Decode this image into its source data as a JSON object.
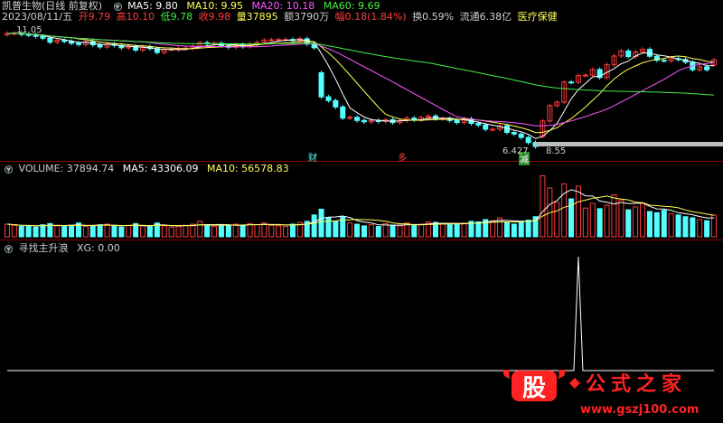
{
  "colors": {
    "up": "#ff3b3b",
    "down": "#54ffff",
    "ma5": "#ffffff",
    "ma10": "#ffff55",
    "ma20": "#ff55ff",
    "ma60": "#44ee44",
    "bg": "#000000"
  },
  "header": {
    "title": "凯普生物(日线 前复权)",
    "ma5": "MA5: 9.80",
    "ma10": "MA10: 9.95",
    "ma20": "MA20: 10.18",
    "ma60": "MA60: 9.69"
  },
  "info": {
    "date": "2023/08/11/五",
    "open": "开9.79",
    "high": "高10.10",
    "low": "低9.78",
    "close": "收9.98",
    "volume": "量37895",
    "amount": "额3790万",
    "change": "幅0.18(1.84%)",
    "turnover": "换0.59%",
    "float": "流通6.38亿",
    "sector": "医疗保健"
  },
  "price_annotations": {
    "high_mark": "11.05",
    "low_mark": "6.427",
    "tag1": "财",
    "tag2": "多",
    "tag3": "减",
    "low_suffix": "8.55"
  },
  "volume_header": {
    "name": "VOLUME: 37894.74",
    "ma5": "MA5: 43306.09",
    "ma10": "MA10: 56578.83"
  },
  "indicator_header": {
    "name": "寻找主升浪",
    "xg": "XG: 0.00"
  },
  "logo": {
    "char": "股",
    "text": "公式之家",
    "url": "www.gszj100.com"
  },
  "chart_data": [
    {
      "type": "candlestick",
      "panel": "price",
      "count": 100,
      "close": [
        10.98,
        10.99,
        10.94,
        10.93,
        10.87,
        10.8,
        10.65,
        10.72,
        10.68,
        10.61,
        10.56,
        10.67,
        10.55,
        10.47,
        10.58,
        10.53,
        10.44,
        10.49,
        10.35,
        10.48,
        10.41,
        10.26,
        10.38,
        10.38,
        10.41,
        10.43,
        10.5,
        10.63,
        10.59,
        10.61,
        10.52,
        10.46,
        10.56,
        10.48,
        10.58,
        10.64,
        10.73,
        10.74,
        10.75,
        10.75,
        10.71,
        10.78,
        10.58,
        10.44,
        8.59,
        8.45,
        8.21,
        7.79,
        7.82,
        7.7,
        7.65,
        7.7,
        7.66,
        7.73,
        7.62,
        7.7,
        7.79,
        7.72,
        7.81,
        7.87,
        7.77,
        7.77,
        7.7,
        7.62,
        7.76,
        7.59,
        7.53,
        7.37,
        7.37,
        7.5,
        7.25,
        7.19,
        7.06,
        6.87,
        6.72,
        7.68,
        8.26,
        8.39,
        9.15,
        9.14,
        9.39,
        9.41,
        9.62,
        9.32,
        9.8,
        10.13,
        10.32,
        10.11,
        10.28,
        10.38,
        10.12,
        9.97,
        9.95,
        10.03,
        10.0,
        9.9,
        9.61,
        9.72,
        9.61,
        9.98
      ],
      "open": [
        10.93,
        10.98,
        10.99,
        10.94,
        10.93,
        10.87,
        10.8,
        10.65,
        10.72,
        10.68,
        10.61,
        10.56,
        10.67,
        10.55,
        10.47,
        10.58,
        10.53,
        10.44,
        10.49,
        10.35,
        10.48,
        10.41,
        10.26,
        10.38,
        10.38,
        10.41,
        10.43,
        10.5,
        10.63,
        10.59,
        10.61,
        10.52,
        10.46,
        10.56,
        10.48,
        10.58,
        10.64,
        10.73,
        10.74,
        10.75,
        10.75,
        10.71,
        10.78,
        10.58,
        9.5,
        8.59,
        8.45,
        8.21,
        7.79,
        7.82,
        7.7,
        7.65,
        7.7,
        7.66,
        7.73,
        7.62,
        7.7,
        7.79,
        7.72,
        7.81,
        7.87,
        7.77,
        7.77,
        7.7,
        7.62,
        7.76,
        7.59,
        7.53,
        7.37,
        7.37,
        7.5,
        7.25,
        7.19,
        7.06,
        6.87,
        7.1,
        7.68,
        8.26,
        8.39,
        9.15,
        9.14,
        9.39,
        9.41,
        9.62,
        9.32,
        9.8,
        10.13,
        10.32,
        10.11,
        10.28,
        10.38,
        10.12,
        9.97,
        9.95,
        10.03,
        10.0,
        9.9,
        9.61,
        9.72,
        9.79
      ]
    },
    {
      "type": "bar",
      "panel": "volume",
      "values": [
        22,
        20,
        18,
        19,
        17,
        21,
        23,
        19,
        18,
        20,
        24,
        18,
        19,
        21,
        22,
        18,
        17,
        20,
        23,
        19,
        18,
        24,
        19,
        17,
        18,
        20,
        22,
        27,
        19,
        18,
        21,
        20,
        22,
        19,
        23,
        21,
        24,
        20,
        19,
        18,
        22,
        25,
        27,
        38,
        48,
        33,
        27,
        35,
        24,
        22,
        19,
        21,
        18,
        23,
        20,
        19,
        24,
        21,
        22,
        26,
        25,
        23,
        21,
        22,
        24,
        27,
        26,
        30,
        28,
        33,
        25,
        22,
        27,
        29,
        35,
        106,
        85,
        60,
        92,
        66,
        88,
        50,
        58,
        49,
        55,
        73,
        64,
        47,
        52,
        58,
        44,
        42,
        46,
        40,
        38,
        35,
        33,
        30,
        28,
        37.9
      ]
    },
    {
      "type": "line",
      "panel": "indicator",
      "series": [
        {
          "name": "XG",
          "spike_index": 80,
          "spike_value": 1,
          "values_otherwise": 0
        }
      ]
    }
  ]
}
